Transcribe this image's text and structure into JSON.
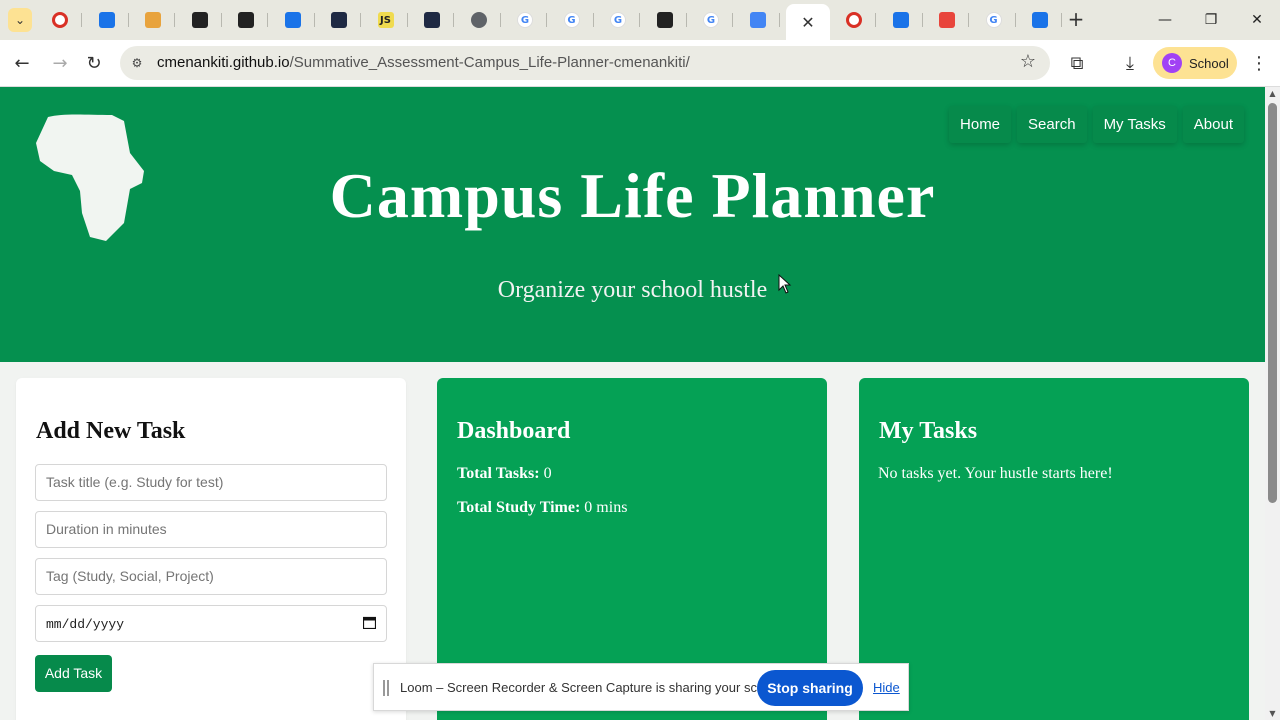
{
  "browser": {
    "tabs": [
      {
        "icon": "opera-red-circle-icon",
        "color": "#d93025"
      },
      {
        "icon": "gear-app-icon",
        "color": "#1a73e8"
      },
      {
        "icon": "stack-icon",
        "color": "#e8a33d"
      },
      {
        "icon": "codepen-icon",
        "color": "#222222"
      },
      {
        "icon": "codepen-icon",
        "color": "#222222"
      },
      {
        "icon": "monitor-icon",
        "color": "#1a73e8"
      },
      {
        "icon": "dark-square-icon",
        "color": "#1f2a44"
      },
      {
        "icon": "js-icon",
        "color": "#f0db4f",
        "label": "JS"
      },
      {
        "icon": "dark-square-icon",
        "color": "#1f2a44"
      },
      {
        "icon": "globe-icon",
        "color": "#5f6368"
      },
      {
        "icon": "google-icon",
        "color": "#4285f4",
        "label": "G"
      },
      {
        "icon": "google-icon",
        "color": "#4285f4",
        "label": "G"
      },
      {
        "icon": "google-icon",
        "color": "#4285f4",
        "label": "G"
      },
      {
        "icon": "github-icon",
        "color": "#222222"
      },
      {
        "icon": "google-icon",
        "color": "#4285f4",
        "label": "G"
      },
      {
        "icon": "docs-icon",
        "color": "#4285f4"
      }
    ],
    "tabs_after": [
      {
        "icon": "opera-red-circle-icon",
        "color": "#d93025"
      },
      {
        "icon": "gear-app-icon",
        "color": "#1a73e8"
      },
      {
        "icon": "rainbow-icon",
        "color": "#e8453c"
      },
      {
        "icon": "google-icon",
        "color": "#4285f4",
        "label": "G"
      },
      {
        "icon": "gear-app-icon",
        "color": "#1a73e8"
      }
    ],
    "url_host": "cmenankiti.github.io",
    "url_path": "/Summative_Assessment-Campus_Life-Planner-cmenankiti/",
    "profile_initial": "C",
    "profile_label": "School"
  },
  "site": {
    "nav": [
      "Home",
      "Search",
      "My Tasks",
      "About"
    ],
    "title": "Campus Life Planner",
    "subtitle": "Organize your school hustle",
    "add_task": {
      "heading": "Add New Task",
      "title_placeholder": "Task title (e.g. Study for test)",
      "duration_placeholder": "Duration in minutes",
      "tag_placeholder": "Tag (Study, Social, Project)",
      "date_placeholder": "mm/dd/yyyy",
      "button": "Add Task"
    },
    "dashboard": {
      "heading": "Dashboard",
      "total_tasks_label": "Total Tasks:",
      "total_tasks_value": "0",
      "study_time_label": "Total Study Time:",
      "study_time_value": "0 mins"
    },
    "my_tasks": {
      "heading": "My Tasks",
      "empty_message": "No tasks yet. Your hustle starts here!"
    },
    "colors": {
      "hero": "#05904f",
      "card": "#05a155",
      "button": "#068a4b"
    }
  },
  "loom": {
    "message": "Loom – Screen Recorder & Screen Capture is sharing your screen.",
    "stop_label": "Stop sharing",
    "hide_label": "Hide"
  }
}
